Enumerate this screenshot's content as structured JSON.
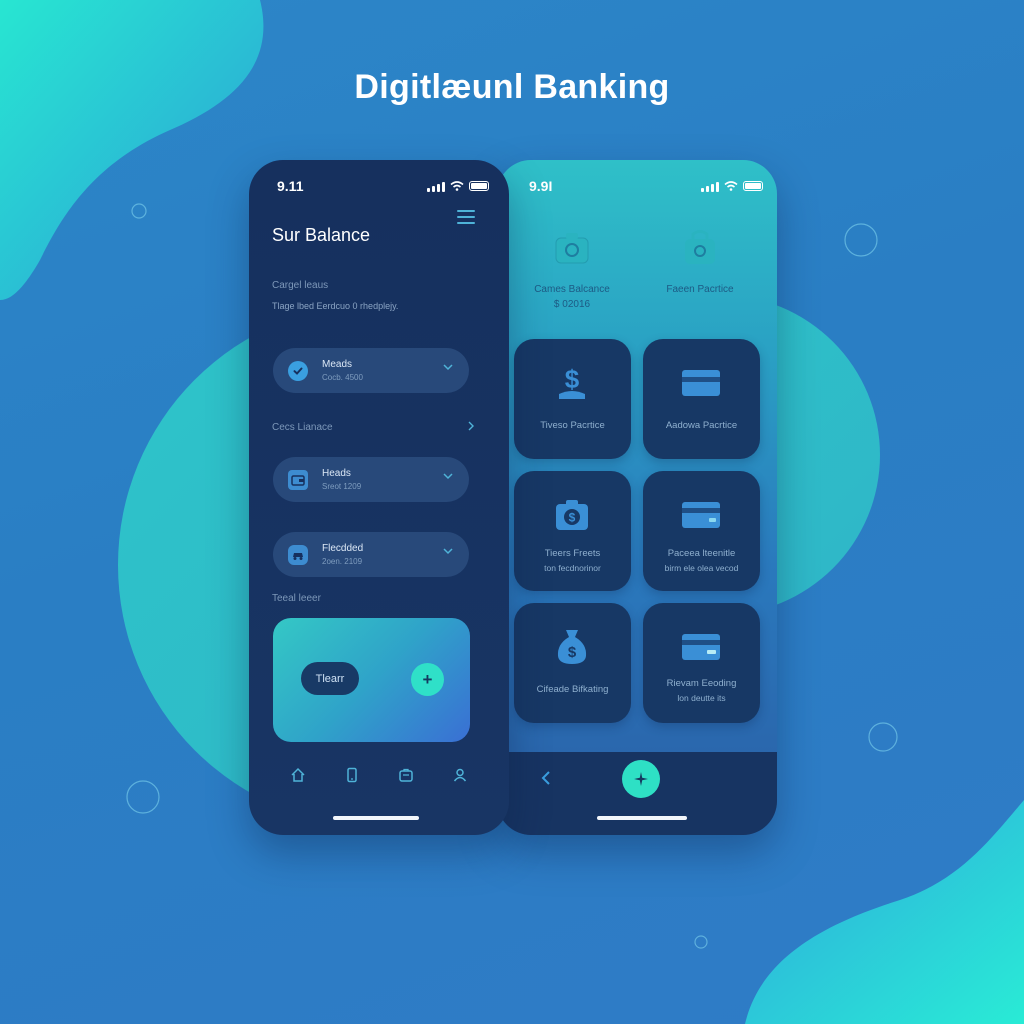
{
  "page": {
    "title": "Digitlæunl Banking"
  },
  "colors": {
    "background": "#2b80c6",
    "accent_teal": "#2fe0c8",
    "left_phone_bg": "#16305e",
    "tile_bg": "#173865",
    "pill_bg": "#28497a"
  },
  "left_phone": {
    "status_time": "9.11",
    "balance_title": "Sur Balance",
    "section1": {
      "label": "Cargel leaus",
      "caption": "Tlage lbed Eerdcuo 0 rhedplejy."
    },
    "account1": {
      "title": "Meads",
      "subtitle": "Cocb. 4500",
      "icon": "check-circle-icon"
    },
    "section2": {
      "label": "Cecs Lianace"
    },
    "account2": {
      "title": "Heads",
      "subtitle": "Sreot 1209",
      "icon": "wallet-icon"
    },
    "account3": {
      "title": "Flecdded",
      "subtitle": "2oen. 2109",
      "icon": "car-icon"
    },
    "section3": {
      "label": "Teeal leeer"
    },
    "promo": {
      "button_label": "Tlearr",
      "add_icon": "plus-icon"
    },
    "nav": [
      "home-icon",
      "phone-icon",
      "briefcase-icon",
      "user-icon"
    ]
  },
  "right_phone": {
    "status_time": "9.9I",
    "top_items": [
      {
        "line1": "Cames Balcance",
        "line2": "$ 02016",
        "icon": "camera-bag-icon"
      },
      {
        "line1": "Faeen Pacrtice",
        "line2": "",
        "icon": "bag-icon"
      }
    ],
    "tiles": [
      {
        "line1": "Tiveso Pacrtice",
        "line2": "",
        "icon": "dollar-hand-icon"
      },
      {
        "line1": "Aadowa Pacrtice",
        "line2": "",
        "icon": "card-icon"
      },
      {
        "line1": "Tieers Freets",
        "line2": "ton fecdnorinor",
        "icon": "camera-dollar-icon"
      },
      {
        "line1": "Paceea lteenitle",
        "line2": "birm ele olea vecod",
        "icon": "card-icon"
      },
      {
        "line1": "Cifeade Bifkating",
        "line2": "",
        "icon": "money-bag-icon"
      },
      {
        "line1": "Rievam Eeoding",
        "line2": "lon deutte its",
        "icon": "card-icon"
      }
    ],
    "fab_icon": "spark-icon",
    "back_icon": "chevron-left-icon"
  }
}
